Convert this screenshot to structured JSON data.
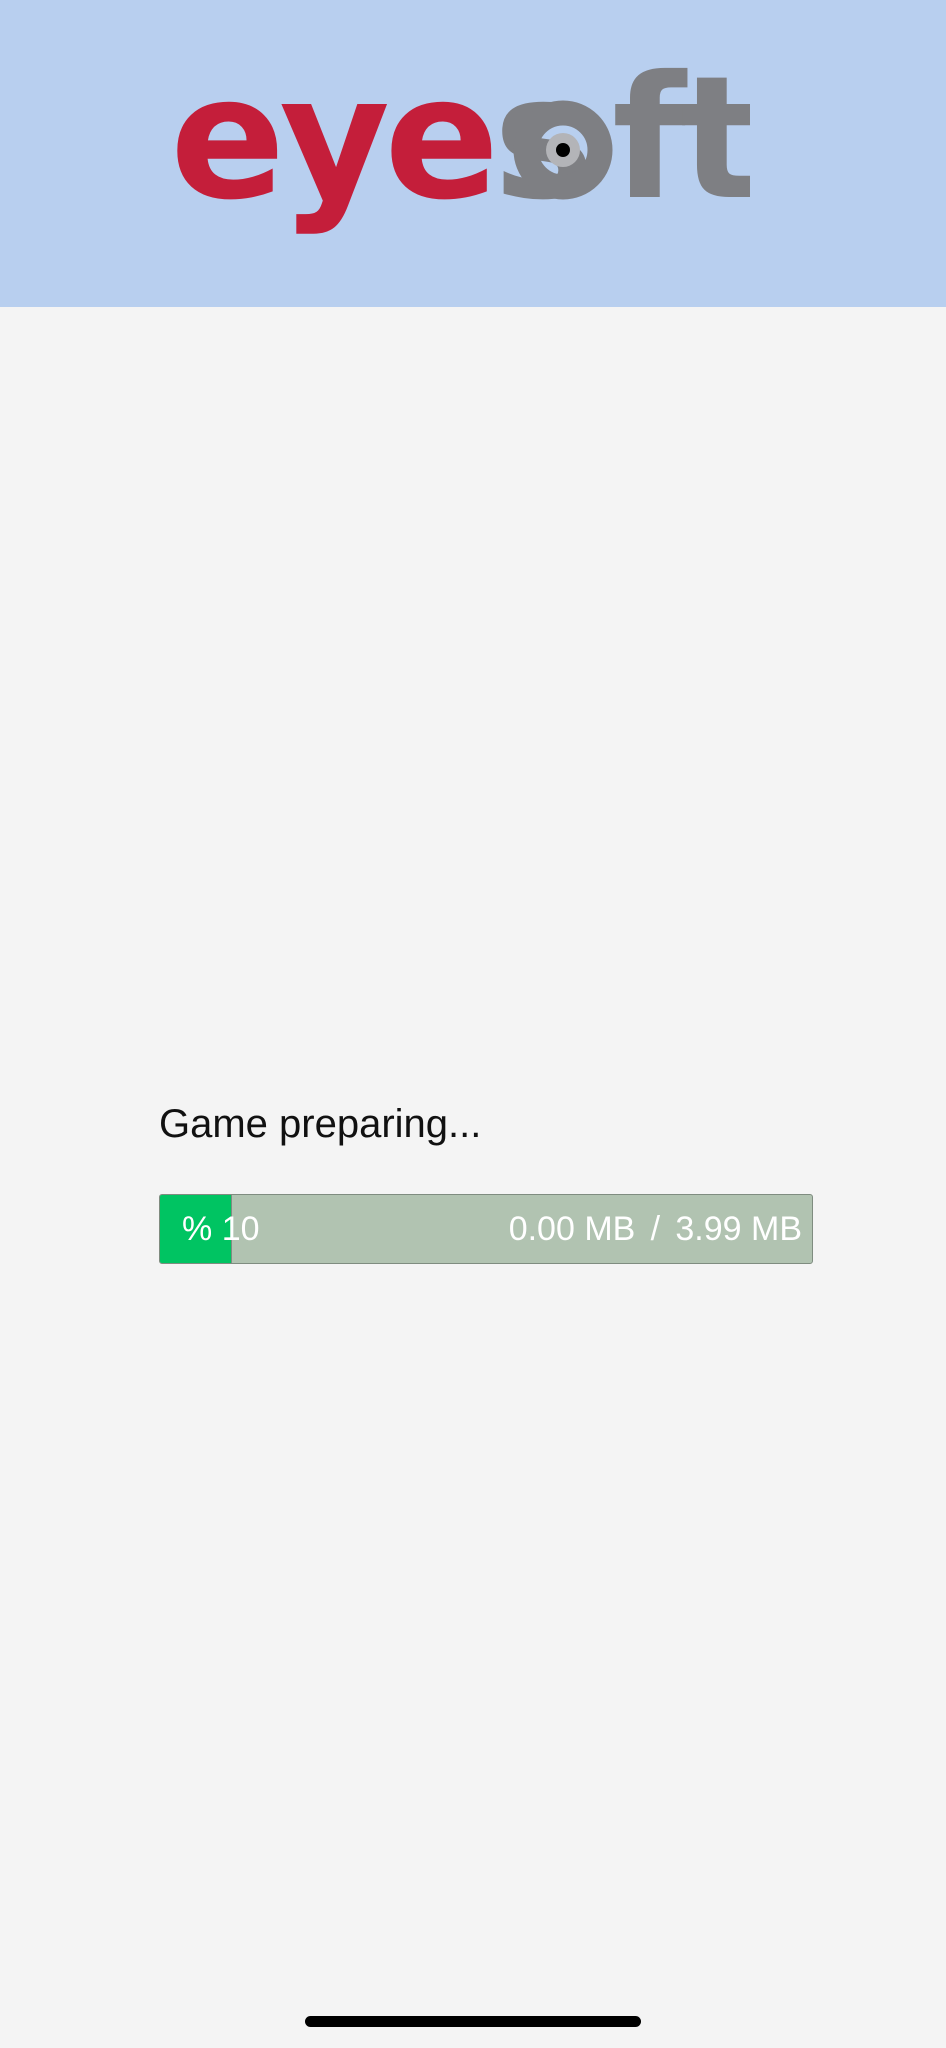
{
  "header": {
    "logo": {
      "part1": "eye",
      "part2": "s",
      "part3": "ft",
      "colors": {
        "primary": "#c41e3a",
        "secondary": "#7e7f83",
        "background": "#b8cfef"
      }
    }
  },
  "status": {
    "label": "Game preparing..."
  },
  "progress": {
    "percent_sign": "%",
    "percent_value": "10",
    "fraction": 0.11,
    "downloaded": "0.00 MB",
    "separator": "/",
    "total": "3.99 MB",
    "colors": {
      "fill": "#00c462",
      "track": "#b1c3b1",
      "text": "#ffffff"
    }
  }
}
